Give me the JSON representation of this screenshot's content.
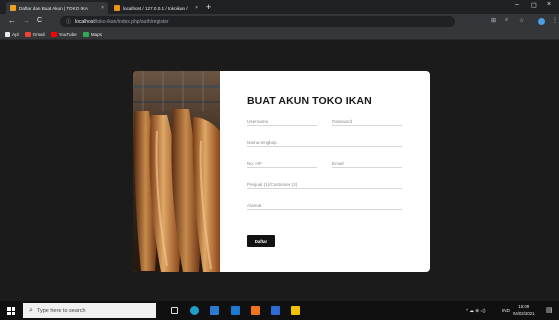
{
  "browser": {
    "tabs": [
      {
        "label": "Daftar dan Buat Akun | TOKO IKA",
        "close": "×",
        "favicon_color": "#f0a020"
      },
      {
        "label": "localhost / 127.0.0.1 / tokoikan /",
        "close": "×",
        "favicon_color": "#f29111"
      }
    ],
    "new_tab": "+",
    "window_controls": {
      "minimize": "–",
      "maximize": "◻",
      "close": "×"
    },
    "nav": {
      "back": "←",
      "forward": "→",
      "reload": "C"
    },
    "url_host": "localhost",
    "url_path": "/toko-ikan/index.php/auth/register",
    "bookmarks": [
      {
        "label": "Apl",
        "icon": "apps-icon",
        "color": "#e8eaed"
      },
      {
        "label": "Gmail",
        "icon": "gmail-icon",
        "color": "#ea4335"
      },
      {
        "label": "YouTube",
        "icon": "youtube-icon",
        "color": "#ff0000"
      },
      {
        "label": "Maps",
        "icon": "maps-icon",
        "color": "#34a853"
      }
    ]
  },
  "form": {
    "title": "BUAT AKUN TOKO IKAN",
    "username": "Username",
    "password": "Password",
    "fullname": "Nama lengkap",
    "phone": "No. HP",
    "email": "Email",
    "role": "Penjual (1)/Customer (2)",
    "address": "Alamat",
    "submit": "Daftar"
  },
  "taskbar": {
    "search_placeholder": "Type here to search",
    "lang": "IND",
    "time": "15:09",
    "date": "04/02/2021",
    "tray_icons": "^  ☁  ⊕  ◁)"
  },
  "colors": {
    "accent": "#121212",
    "page_bg": "#1b1b1b",
    "chrome_bg": "#35363a"
  }
}
